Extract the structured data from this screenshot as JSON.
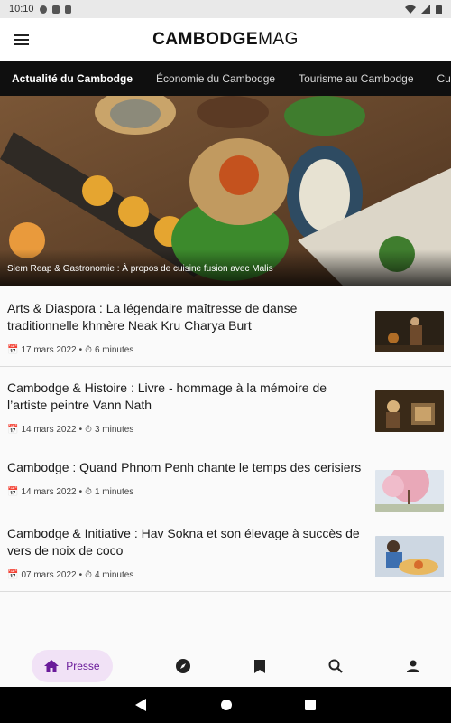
{
  "status_bar": {
    "time": "10:10"
  },
  "app": {
    "logo_bold": "CAMBODGE",
    "logo_light": "MAG"
  },
  "tabs": [
    {
      "label": "Actualité du Cambodge"
    },
    {
      "label": "Économie du Cambodge"
    },
    {
      "label": "Tourisme au Cambodge"
    },
    {
      "label": "Cultur"
    }
  ],
  "hero": {
    "caption": "Siem Reap & Gastronomie : À propos de cuisine fusion avec Malis"
  },
  "articles": [
    {
      "title": "Arts & Diaspora : La légendaire maîtresse de danse traditionnelle khmère Neak Kru Charya Burt",
      "date": "17 mars 2022",
      "read_time": "6 minutes"
    },
    {
      "title": "Cambodge & Histoire : Livre - hommage à la mémoire de l’artiste peintre Vann Nath",
      "date": "14 mars 2022",
      "read_time": "3 minutes"
    },
    {
      "title": "Cambodge : Quand Phnom Penh chante le temps des cerisiers",
      "date": "14 mars 2022",
      "read_time": "1 minutes"
    },
    {
      "title": "Cambodge & Initiative : Hav Sokna et son élevage à succès de vers de noix de coco",
      "date": "07 mars 2022",
      "read_time": "4 minutes"
    }
  ],
  "bottom_nav": {
    "active_label": "Presse"
  },
  "colors": {
    "accent": "#6a1b9a",
    "active_pill": "#f1e2f6",
    "tab_bar": "#0f0f0f"
  }
}
